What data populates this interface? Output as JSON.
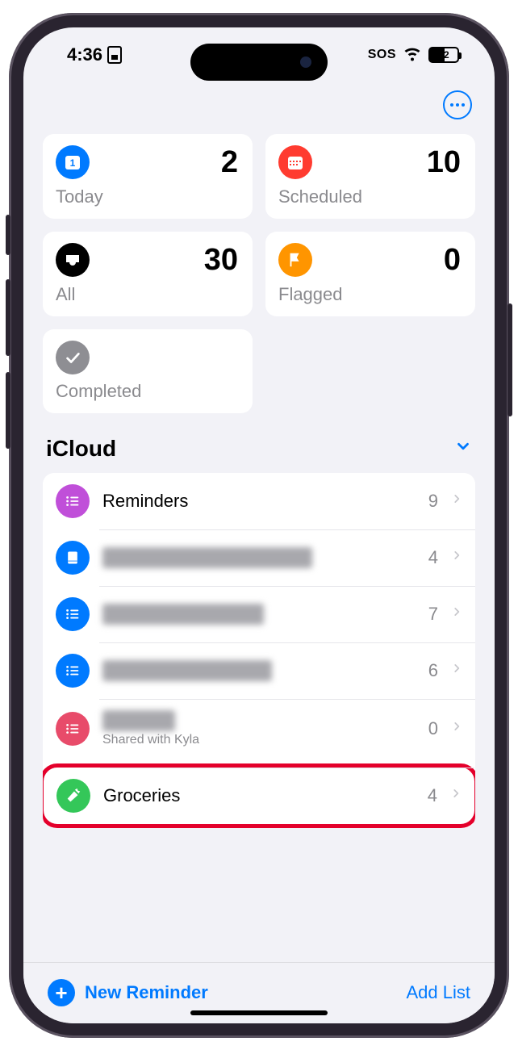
{
  "status": {
    "time": "4:36",
    "sos": "SOS",
    "battery": "52"
  },
  "smart": {
    "today": {
      "label": "Today",
      "count": "2"
    },
    "scheduled": {
      "label": "Scheduled",
      "count": "10"
    },
    "all": {
      "label": "All",
      "count": "30"
    },
    "flagged": {
      "label": "Flagged",
      "count": "0"
    },
    "completed": {
      "label": "Completed"
    }
  },
  "section": {
    "title": "iCloud"
  },
  "lists": [
    {
      "name": "Reminders",
      "count": "9",
      "color": "bg-purple"
    },
    {
      "name": "",
      "count": "4",
      "color": "bg-blue",
      "blurWidth": 260
    },
    {
      "name": "",
      "count": "7",
      "color": "bg-blue",
      "blurWidth": 200
    },
    {
      "name": "",
      "count": "6",
      "color": "bg-blue",
      "blurWidth": 210
    },
    {
      "name": "",
      "sub": "Shared with Kyla",
      "count": "0",
      "color": "bg-rose",
      "blurWidth": 90
    },
    {
      "name": "Groceries",
      "count": "4",
      "color": "bg-green",
      "highlight": true
    }
  ],
  "toolbar": {
    "new_reminder": "New Reminder",
    "add_list": "Add List"
  }
}
